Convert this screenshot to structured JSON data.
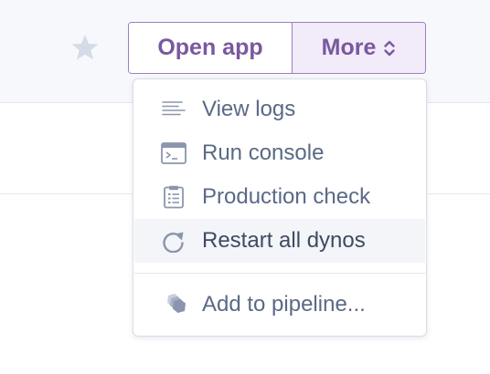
{
  "header": {
    "open_app_label": "Open app",
    "more_label": "More"
  },
  "icons": {
    "favorite": "star-icon",
    "more_toggle": "chevron-up-down-icon"
  },
  "colors": {
    "accent": "#79589f",
    "accent_border": "#9b7fc0",
    "more_bg": "#f2ebfa",
    "menu_text": "#5a6986",
    "icon": "#8b95ad",
    "highlight_bg": "#f4f5f9"
  },
  "dropdown": {
    "items": [
      {
        "label": "View logs",
        "icon": "logs-icon"
      },
      {
        "label": "Run console",
        "icon": "console-icon"
      },
      {
        "label": "Production check",
        "icon": "clipboard-icon"
      },
      {
        "label": "Restart all dynos",
        "icon": "restart-icon",
        "highlighted": true
      }
    ],
    "footer_item": {
      "label": "Add to pipeline...",
      "icon": "pipeline-icon"
    }
  }
}
